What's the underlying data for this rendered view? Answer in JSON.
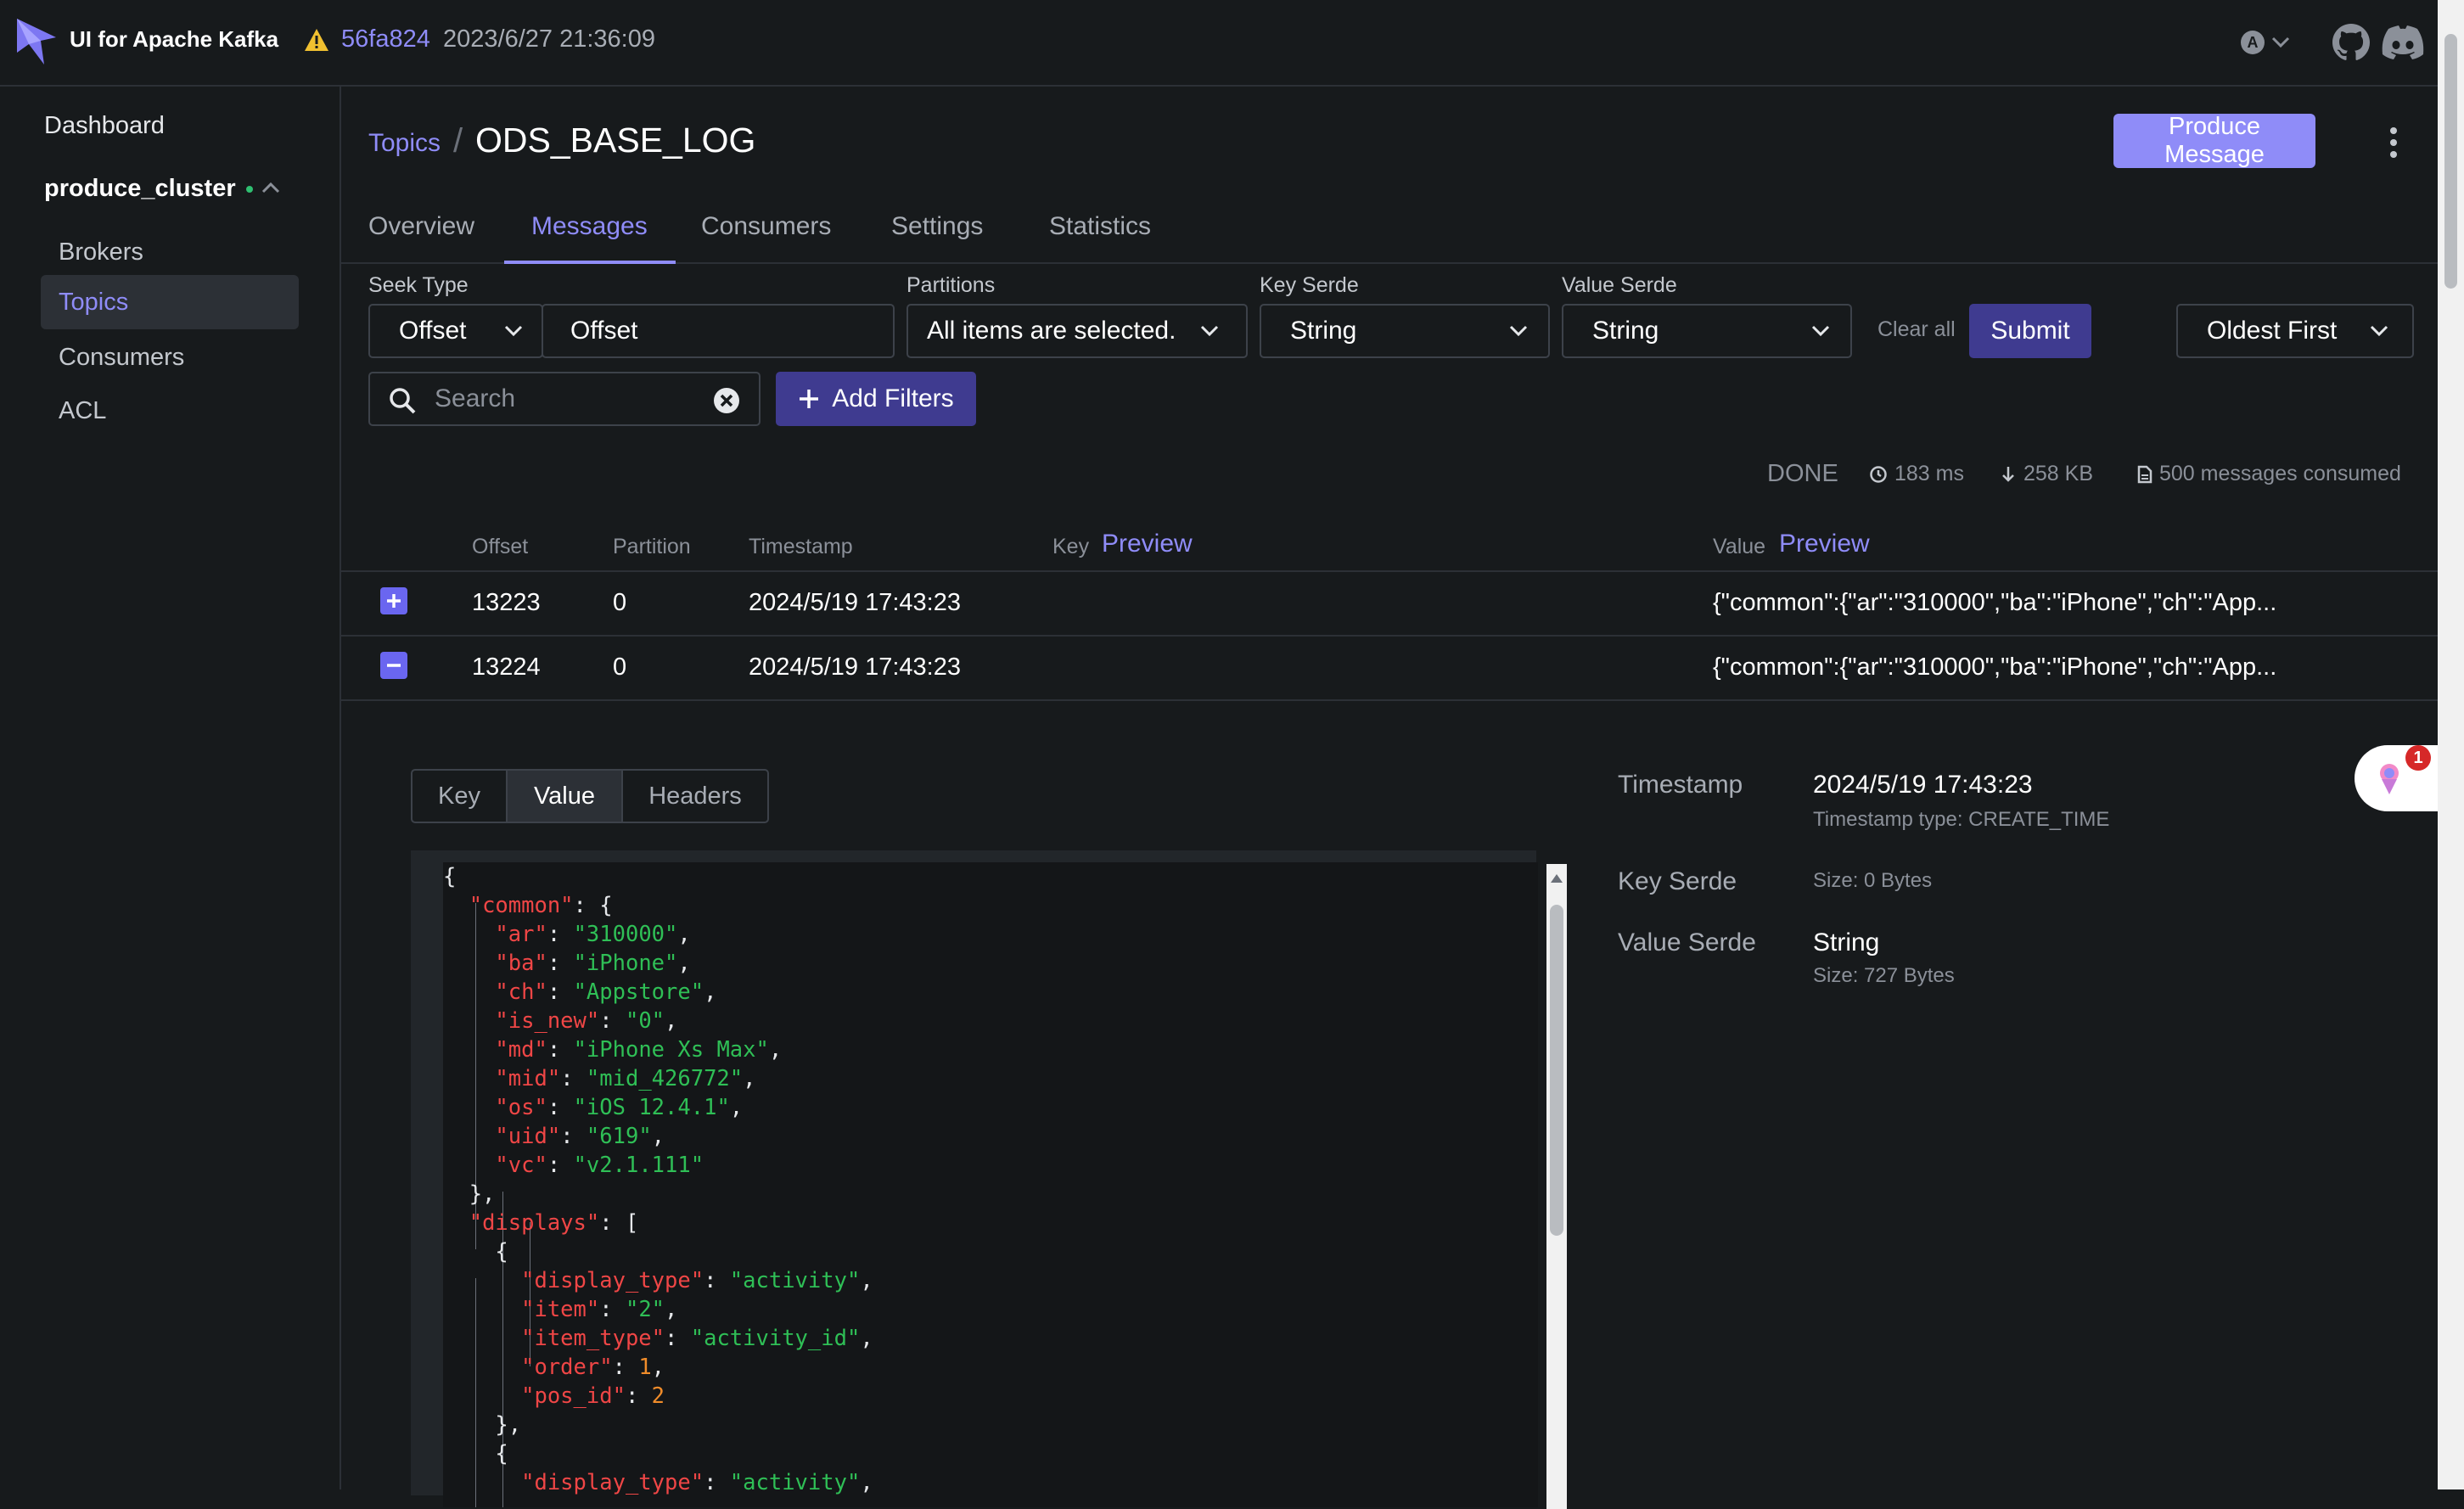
{
  "navbar": {
    "app_title": "UI for Apache Kafka",
    "version": "56fa824",
    "build_date": "2023/6/27 21:36:09",
    "theme_letter": "A"
  },
  "sidebar": {
    "dashboard": "Dashboard",
    "cluster_name": "produce_cluster",
    "items": [
      {
        "label": "Brokers"
      },
      {
        "label": "Topics"
      },
      {
        "label": "Consumers"
      },
      {
        "label": "ACL"
      }
    ]
  },
  "header": {
    "breadcrumb": "Topics",
    "title": "ODS_BASE_LOG",
    "produce_label": "Produce Message"
  },
  "tabs": [
    "Overview",
    "Messages",
    "Consumers",
    "Settings",
    "Statistics"
  ],
  "filters": {
    "seek_type_label": "Seek Type",
    "seek_type_value": "Offset",
    "offset_value": "Offset",
    "partitions_label": "Partitions",
    "partitions_value": "All items are selected.",
    "key_serde_label": "Key Serde",
    "key_serde_value": "String",
    "value_serde_label": "Value Serde",
    "value_serde_value": "String",
    "clear_all": "Clear all",
    "submit": "Submit",
    "order_value": "Oldest First",
    "search_placeholder": "Search",
    "add_filters": "Add Filters"
  },
  "status": {
    "state": "DONE",
    "elapsed": "183 ms",
    "bytes": "258 KB",
    "consumed": "500 messages consumed"
  },
  "table": {
    "headers": {
      "offset": "Offset",
      "partition": "Partition",
      "timestamp": "Timestamp",
      "key": "Key",
      "key_preview": "Preview",
      "value": "Value",
      "value_preview": "Preview"
    },
    "rows": [
      {
        "offset": "13223",
        "partition": "0",
        "timestamp": "2024/5/19 17:43:23",
        "value": "{\"common\":{\"ar\":\"310000\",\"ba\":\"iPhone\",\"ch\":\"App..."
      },
      {
        "offset": "13224",
        "partition": "0",
        "timestamp": "2024/5/19 17:43:23",
        "value": "{\"common\":{\"ar\":\"310000\",\"ba\":\"iPhone\",\"ch\":\"App..."
      }
    ]
  },
  "detail": {
    "tabs": [
      "Key",
      "Value",
      "Headers"
    ],
    "json_lines": [
      "{",
      "  \"common\": {",
      "    \"ar\": \"310000\",",
      "    \"ba\": \"iPhone\",",
      "    \"ch\": \"Appstore\",",
      "    \"is_new\": \"0\",",
      "    \"md\": \"iPhone Xs Max\",",
      "    \"mid\": \"mid_426772\",",
      "    \"os\": \"iOS 12.4.1\",",
      "    \"uid\": \"619\",",
      "    \"vc\": \"v2.1.111\"",
      "  },",
      "  \"displays\": [",
      "    {",
      "      \"display_type\": \"activity\",",
      "      \"item\": \"2\",",
      "      \"item_type\": \"activity_id\",",
      "      \"order\": 1,",
      "      \"pos_id\": 2",
      "    },",
      "    {",
      "      \"display_type\": \"activity\","
    ],
    "timestamp_label": "Timestamp",
    "timestamp_value": "2024/5/19 17:43:23",
    "timestamp_type": "Timestamp type: CREATE_TIME",
    "key_serde_label": "Key Serde",
    "key_size": "Size: 0 Bytes",
    "value_serde_label": "Value Serde",
    "value_serde_value": "String",
    "value_size": "Size: 727 Bytes",
    "widget_badge": "1"
  },
  "colors": {
    "accent": "#8f8cf8",
    "button_dark": "#3f3b90",
    "background": "#171a1c",
    "json_key": "#ef4646",
    "json_string": "#2fbf56",
    "json_number": "#f08c2a"
  }
}
